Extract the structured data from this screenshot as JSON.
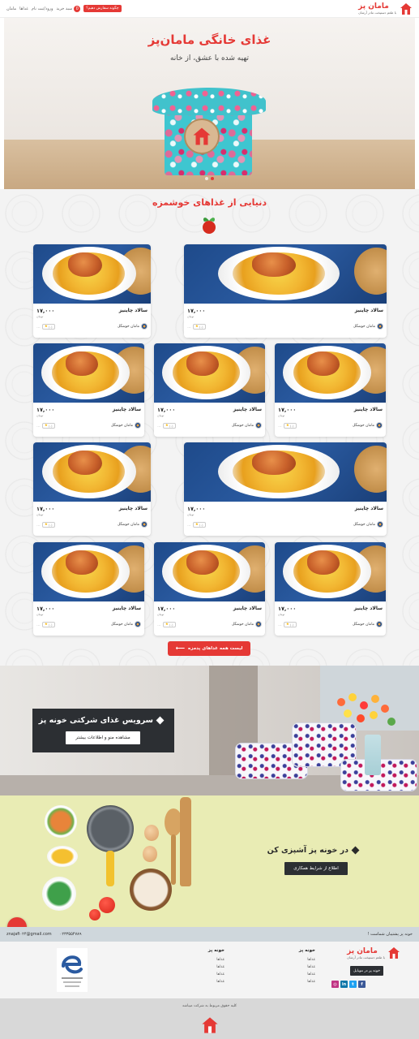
{
  "header": {
    "brand": "ماماﻥ پز",
    "tagline": "با طعم دستپخت مادر آرشان",
    "cart_label": "سبد خرید",
    "cart_count": "0",
    "login_label": "ورود/ثبت نام",
    "nav_food": "غذاها",
    "nav_mamans": "ماماﻥ",
    "cta_label": "چگونه سفارش دهیم؟"
  },
  "hero": {
    "title": "غذای خانگی ماماﻥ‌پز",
    "subtitle": "تهیه شده با عشق، از خانه"
  },
  "foods": {
    "section_title": "دنیایی از غذاهای خوشمزه",
    "all_button": "لیست همه غذاهای پدمزه",
    "cards": [
      {
        "name": "سالاد چاینیز",
        "price": "۱۷,۰۰۰",
        "unit": "تومان",
        "chef": "مامان خوشگل",
        "rating": "۰.۰",
        "count": "(۰)"
      },
      {
        "name": "سالاد چاینیز",
        "price": "۱۷,۰۰۰",
        "unit": "تومان",
        "chef": "مامان خوشگل",
        "rating": "۰.۰",
        "count": "(۰)"
      },
      {
        "name": "سالاد چاینیز",
        "price": "۱۷,۰۰۰",
        "unit": "تومان",
        "chef": "مامان خوشگل",
        "rating": "۰.۰",
        "count": "(۰)"
      },
      {
        "name": "سالاد چاینیز",
        "price": "۱۷,۰۰۰",
        "unit": "تومان",
        "chef": "مامان خوشگل",
        "rating": "۰.۰",
        "count": "(۰)"
      },
      {
        "name": "سالاد چاینیز",
        "price": "۱۷,۰۰۰",
        "unit": "تومان",
        "chef": "مامان خوشگل",
        "rating": "۰.۰",
        "count": "(۰)"
      },
      {
        "name": "سالاد چاینیز",
        "price": "۱۷,۰۰۰",
        "unit": "تومان",
        "chef": "مامان خوشگل",
        "rating": "۰.۰",
        "count": "(۰)"
      },
      {
        "name": "سالاد چاینیز",
        "price": "۱۷,۰۰۰",
        "unit": "تومان",
        "chef": "مامان خوشگل",
        "rating": "۰.۰",
        "count": "(۰)"
      },
      {
        "name": "سالاد چاینیز",
        "price": "۱۷,۰۰۰",
        "unit": "تومان",
        "chef": "مامان خوشگل",
        "rating": "۰.۰",
        "count": "(۰)"
      },
      {
        "name": "سالاد چاینیز",
        "price": "۱۷,۰۰۰",
        "unit": "تومان",
        "chef": "مامان خوشگل",
        "rating": "۰.۰",
        "count": "(۰)"
      },
      {
        "name": "سالاد چاینیز",
        "price": "۱۷,۰۰۰",
        "unit": "تومان",
        "chef": "مامان خوشگل",
        "rating": "۰.۰",
        "count": "(۰)"
      }
    ]
  },
  "corporate": {
    "title": "سرویس غذای شرکتی خونه پز",
    "button": "مشاهده منو و اطلاعات بیشتر"
  },
  "cook": {
    "title": "در خونه پز آشپزی کن",
    "button": "اطلاع از شرایط همکاری"
  },
  "contact": {
    "email": "znajafi۰۲۴@gmail.com",
    "phone": "۰۲۳۳۵۵۴۷۸۹",
    "slogan": "خونه پز پشتیبان شماست !"
  },
  "footer": {
    "brand": "ماماﻥ پز",
    "tagline": "با طعم دستپخت مادر آرشان",
    "mobile_btn": "خونه پز در موبایل",
    "col1_title": "خونه پز",
    "col1_items": [
      "غذاها",
      "غذاها",
      "غذاها",
      "غذاها"
    ],
    "col2_title": "خونه پز",
    "col2_items": [
      "غذاها",
      "غذاها",
      "غذاها",
      "غذاها"
    ],
    "social": [
      "f",
      "t",
      "in",
      "ig"
    ],
    "copyright": "کلیه حقوق مربوط به شرکت میباشد"
  },
  "colors": {
    "accent": "#e53935",
    "dark": "#2c2f33",
    "cook_bg": "#e9ecb4"
  }
}
